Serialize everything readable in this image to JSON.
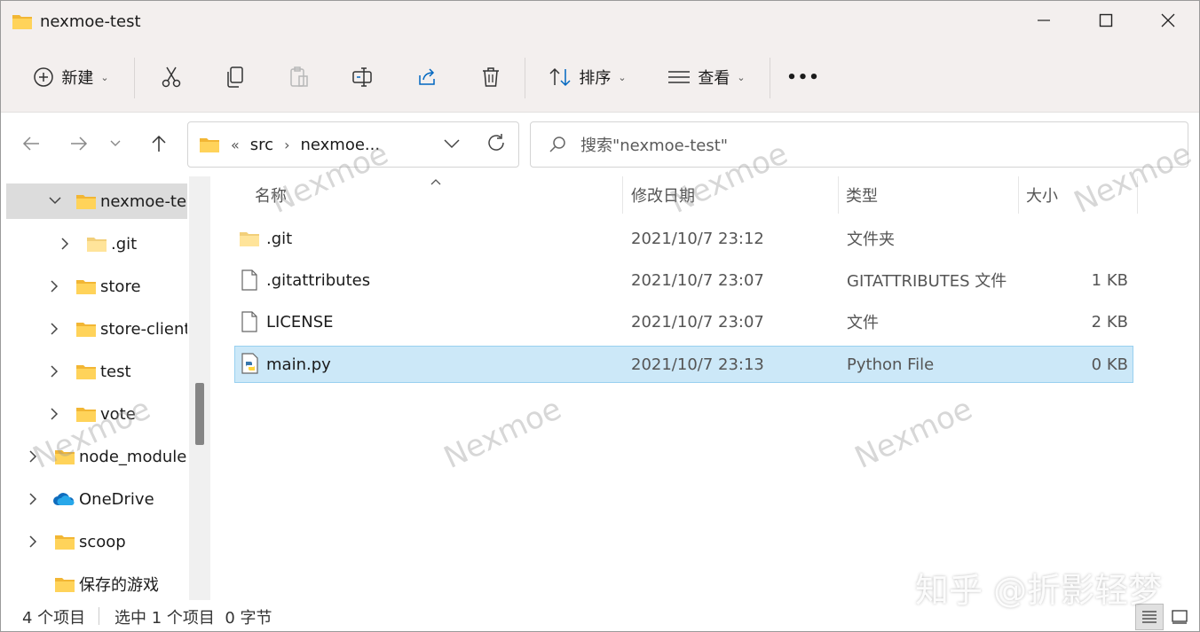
{
  "window": {
    "title": "nexmoe-test",
    "accent": "#ffc83d"
  },
  "toolbar": {
    "new_label": "新建",
    "sort_label": "排序",
    "view_label": "查看",
    "more_label": "•••"
  },
  "nav": {
    "address_overflow": "«",
    "address_path": [
      "src",
      "nexmoe..."
    ],
    "search_placeholder": "搜索\"nexmoe-test\""
  },
  "sidebar": {
    "items": [
      {
        "label": "nexmoe-test",
        "expanded": true,
        "selected": true,
        "icon": "folder-icon"
      },
      {
        "label": ".git",
        "icon": "folder-icon"
      },
      {
        "label": "store",
        "icon": "folder-icon"
      },
      {
        "label": "store-client",
        "icon": "folder-icon"
      },
      {
        "label": "test",
        "icon": "folder-icon"
      },
      {
        "label": "vote",
        "icon": "folder-icon"
      },
      {
        "label": "node_modules",
        "icon": "folder-icon"
      },
      {
        "label": "OneDrive",
        "icon": "cloud-icon"
      },
      {
        "label": "scoop",
        "icon": "folder-icon"
      },
      {
        "label": "保存的游戏",
        "icon": "folder-icon"
      }
    ]
  },
  "files": {
    "columns": {
      "name": "名称",
      "modified": "修改日期",
      "type": "类型",
      "size": "大小"
    },
    "rows": [
      {
        "name": ".git",
        "modified": "2021/10/7 23:12",
        "type": "文件夹",
        "size": "",
        "icon": "folder-icon"
      },
      {
        "name": ".gitattributes",
        "modified": "2021/10/7 23:07",
        "type": "GITATTRIBUTES 文件",
        "size": "1 KB",
        "icon": "file-icon"
      },
      {
        "name": "LICENSE",
        "modified": "2021/10/7 23:07",
        "type": "文件",
        "size": "2 KB",
        "icon": "file-icon"
      },
      {
        "name": "main.py",
        "modified": "2021/10/7 23:13",
        "type": "Python File",
        "size": "0 KB",
        "icon": "python-file-icon",
        "selected": true
      }
    ]
  },
  "status": {
    "item_count": "4 个项目",
    "selection": "选中 1 个项目  0 字节"
  },
  "watermark": {
    "text": "Nexmoe",
    "zhihu": "知乎 @折影轻梦"
  }
}
